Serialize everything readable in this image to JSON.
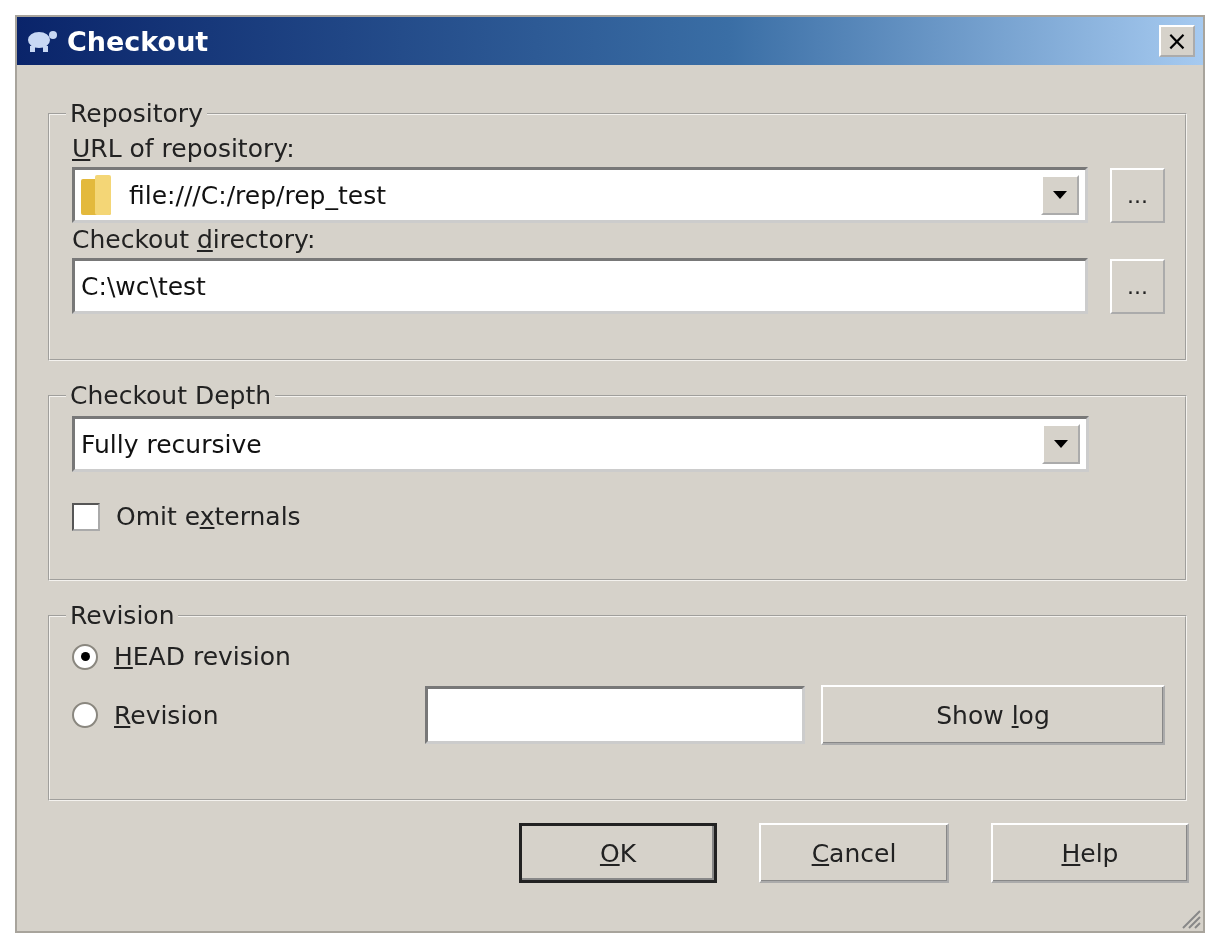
{
  "window": {
    "title": "Checkout",
    "close_label": "×"
  },
  "repository": {
    "legend": "Repository",
    "url_label": {
      "key": "U",
      "rest": "RL of repository:"
    },
    "url_value": "file:///C:/rep/rep_test",
    "url_browse": "...",
    "dir_label": {
      "pre": "Checkout ",
      "key": "d",
      "rest": "irectory:"
    },
    "dir_value": "C:\\wc\\test",
    "dir_browse": "..."
  },
  "depth": {
    "legend": "Checkout Depth",
    "value": "Fully recursive",
    "omit_externals": {
      "label": {
        "pre": "Omit e",
        "key": "x",
        "rest": "ternals"
      },
      "checked": false
    }
  },
  "revision": {
    "legend": "Revision",
    "options": [
      {
        "label": {
          "key": "H",
          "rest": "EAD revision"
        },
        "selected": true
      },
      {
        "label": {
          "key": "R",
          "rest": "evision"
        },
        "selected": false
      }
    ],
    "show_log": {
      "pre": "Show ",
      "key": "l",
      "rest": "og"
    }
  },
  "buttons": [
    {
      "label": {
        "key": "O",
        "rest": "K"
      },
      "default": true
    },
    {
      "label": {
        "key": "C",
        "rest": "ancel"
      },
      "default": false
    },
    {
      "label": {
        "key": "H",
        "rest": "elp"
      },
      "default": false
    }
  ]
}
